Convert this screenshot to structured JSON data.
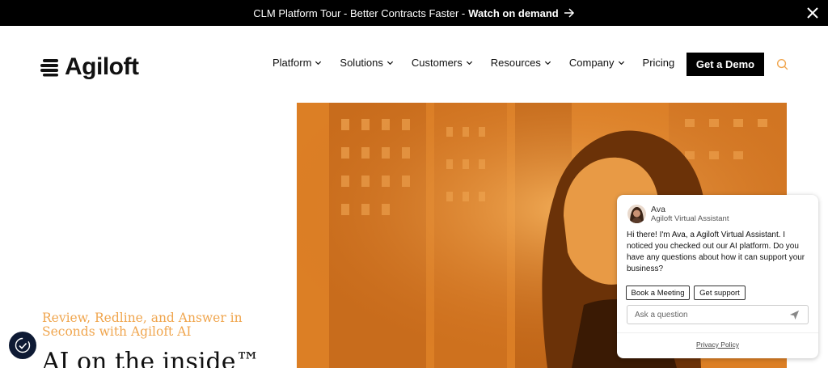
{
  "announcement": {
    "text": "CLM Platform Tour - Better Contracts Faster -",
    "link_label": "Watch on demand",
    "arrow_icon": "arrow-right-icon",
    "close_icon": "close-icon"
  },
  "header": {
    "logo_text": "Agiloft",
    "nav": [
      {
        "label": "Platform",
        "has_dropdown": true
      },
      {
        "label": "Solutions",
        "has_dropdown": true
      },
      {
        "label": "Customers",
        "has_dropdown": true
      },
      {
        "label": "Resources",
        "has_dropdown": true
      },
      {
        "label": "Company",
        "has_dropdown": true
      },
      {
        "label": "Pricing",
        "has_dropdown": false
      }
    ],
    "cta_label": "Get a Demo",
    "search_icon": "search-icon"
  },
  "hero": {
    "subheading": "Review, Redline, and Answer in Seconds with Agiloft AI",
    "heading": "AI on the inside™"
  },
  "chat_widget": {
    "agent_name": "Ava",
    "agent_role": "Agiloft Virtual Assistant",
    "message": "Hi there! I'm Ava, a Agiloft Virtual Assistant. I noticed you checked out our AI platform. Do you have any questions about how it can support your business?",
    "quick_replies": [
      "Book a Meeting",
      "Get support"
    ],
    "input_placeholder": "Ask a question",
    "privacy_label": "Privacy Policy"
  },
  "colors": {
    "accent_orange": "#f0a64f",
    "hero_orange": "#e4892a",
    "topbar_bg": "#000000",
    "a11y_bg": "#0e1a34"
  }
}
